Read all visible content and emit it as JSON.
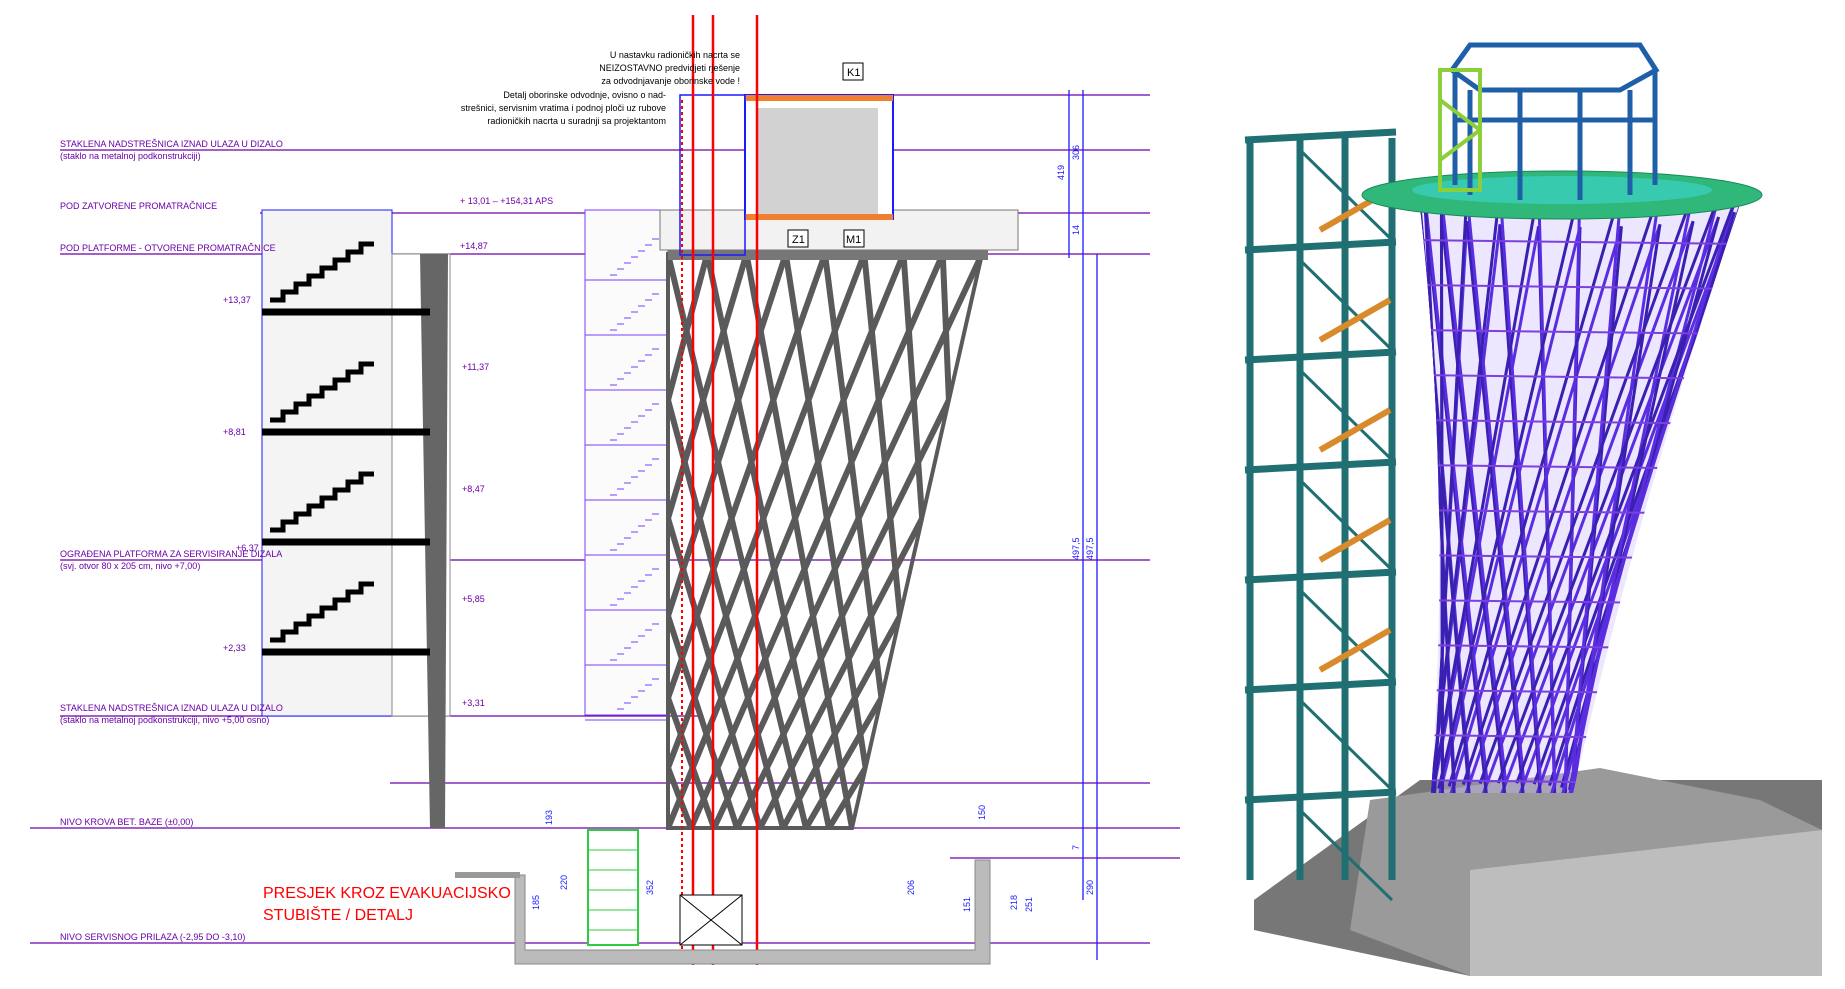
{
  "drawing": {
    "title_line1": "PRESJEK KROZ EVAKUACIJSKO",
    "title_line2": "STUBIŠTE / DETALJ",
    "level_labels": [
      {
        "text": "STAKLENA NADSTREŠNICA IZNAD ULAZA U DIZALO",
        "sub": "(staklo na metalnoj podkonstrukciji)"
      },
      {
        "text": "POD ZATVORENE PROMATRAČNICE",
        "sub": ""
      },
      {
        "text": "POD PLATFORME - OTVORENE PROMATRAČNICE",
        "sub": ""
      },
      {
        "text": "OGRAĐENA PLATFORMA ZA SERVISIRANJE DIZALA",
        "sub": "(svj. otvor 80 x 205 cm, nivo +7,00)"
      },
      {
        "text": "STAKLENA NADSTREŠNICA IZNAD ULAZA U DIZALO",
        "sub": "(staklo na metalnoj podkonstrukciji, nivo +5,00 osno)"
      },
      {
        "text": "NIVO KROVA BET. BAZE (±0,00)",
        "sub": ""
      },
      {
        "text": "NIVO SERVISNOG PRILAZA (-2,95 DO -3,10)",
        "sub": ""
      }
    ],
    "elevations": {
      "top": "+ 13,01 – +154,31 APS",
      "platform": "+14,87",
      "left": [
        "+13,37",
        "+8,81",
        "+6,37",
        "+2,33"
      ],
      "right": [
        "+11,37",
        "+8,47",
        "+5,85",
        "+3,31"
      ]
    },
    "notes": {
      "note1": [
        "U nastavku radioničkih nacrta se",
        "NEIZOSTAVNO predvidjeti rješenje",
        "za odvodnjavanje oborinske vode !"
      ],
      "note2": [
        "Detalj oborinske odvodnje, ovisno o nad-",
        "strešnici, servisnim vratima i podnoj ploči uz rubove",
        "radioničkih nacrta u suradnji sa projektantom"
      ]
    },
    "tags": [
      "K1",
      "Z1",
      "M1"
    ],
    "dimensions": {
      "right": [
        "419",
        "306",
        "14",
        "497,5",
        "497,5",
        "7",
        "290"
      ],
      "base": [
        "150",
        "193",
        "220",
        "185",
        "352",
        "251",
        "206",
        "151",
        "218"
      ]
    },
    "colors": {
      "level_line": "#6a00a8",
      "lattice": "#555555",
      "dimension": "#1a1aff",
      "axis": "#ff0000",
      "hyperboloid": "#5a2de0",
      "frame": "#1f6f73",
      "deck": "#2fb87a"
    }
  }
}
